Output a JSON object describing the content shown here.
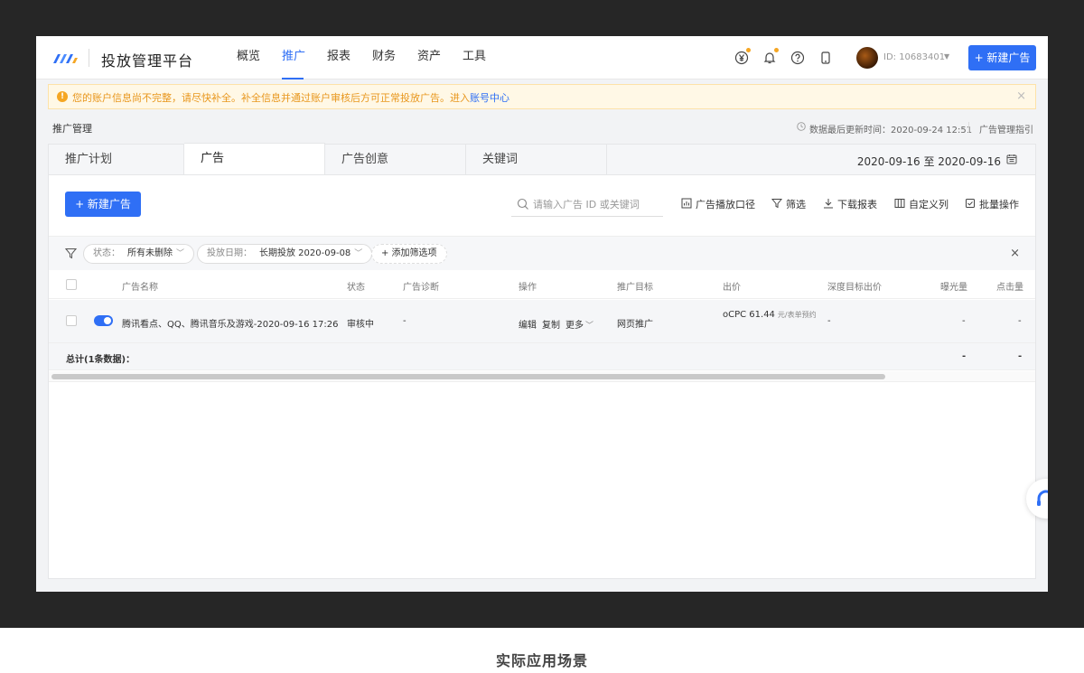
{
  "app": {
    "title": "投放管理平台",
    "colors": {
      "accent": "#2f6ff5",
      "warning": "#f5a623",
      "frame": "#262626"
    }
  },
  "nav": {
    "items": [
      {
        "label": "概览",
        "active": false
      },
      {
        "label": "推广",
        "active": true
      },
      {
        "label": "报表",
        "active": false
      },
      {
        "label": "财务",
        "active": false
      },
      {
        "label": "资产",
        "active": false
      },
      {
        "label": "工具",
        "active": false
      }
    ],
    "icons": [
      "yuan-icon",
      "bell-icon",
      "help-icon",
      "mobile-icon"
    ],
    "user_id": "ID: 10683401",
    "new_ad_label": "+ 新建广告"
  },
  "alert": {
    "text": "您的账户信息尚不完整，请尽快补全。补全信息并通过账户审核后方可正常投放广告。进入",
    "link": "账号中心",
    "close": "×"
  },
  "page": {
    "title": "推广管理",
    "last_update": "数据最后更新时间：2020-09-24 12:51",
    "guide": "广告管理指引"
  },
  "tabs": [
    {
      "label": "推广计划",
      "active": false
    },
    {
      "label": "广告",
      "active": true
    },
    {
      "label": "广告创意",
      "active": false
    },
    {
      "label": "关键词",
      "active": false
    }
  ],
  "date_range": "2020-09-16 至 2020-09-16",
  "toolbar": {
    "new_ad": "+ 新建广告",
    "search_placeholder": "请输入广告 ID 或关键词",
    "tools": [
      "广告播放口径",
      "筛选",
      "下载报表",
      "自定义列",
      "批量操作"
    ]
  },
  "filters": {
    "chips": [
      {
        "key": "状态：",
        "value": "所有未删除"
      },
      {
        "key": "投放日期：",
        "value": "长期投放 2020-09-08"
      }
    ],
    "add": "+ 添加筛选项",
    "close": "×"
  },
  "table": {
    "columns": [
      "广告名称",
      "状态",
      "广告诊断",
      "操作",
      "推广目标",
      "出价",
      "深度目标出价",
      "曝光量",
      "点击量"
    ],
    "rows": [
      {
        "enabled": true,
        "name": "腾讯看点、QQ、腾讯音乐及游戏-2020-09-16 17:26",
        "status": "审核中",
        "diagnosis": "-",
        "actions": [
          "编辑",
          "复制",
          "更多"
        ],
        "target": "网页推广",
        "bid": "oCPC  61.44",
        "bid_unit": "元/表单预约",
        "deep_bid": "-",
        "impressions": "-",
        "clicks": "-"
      }
    ],
    "total": {
      "label": "总计(1条数据)：",
      "impressions": "-",
      "clicks": "-"
    }
  },
  "caption": "实际应用场景"
}
